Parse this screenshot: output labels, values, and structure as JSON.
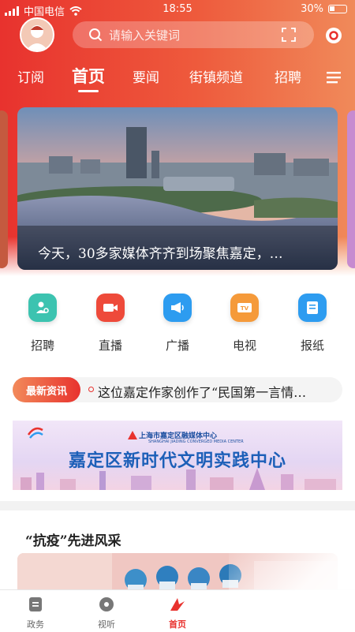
{
  "status_bar": {
    "carrier": "中国电信",
    "time": "18:55",
    "battery": "30%"
  },
  "search": {
    "placeholder": "请输入关键词"
  },
  "nav": {
    "tabs": [
      "订阅",
      "首页",
      "要闻",
      "街镇频道",
      "招聘"
    ],
    "active": "首页"
  },
  "banner": {
    "caption": "今天，30多家媒体齐齐到场聚焦嘉定，…"
  },
  "quick_actions": [
    {
      "label": "招聘",
      "icon": "person-search-icon",
      "color": "#3cc3b0"
    },
    {
      "label": "直播",
      "icon": "video-camera-icon",
      "color": "#ee4a3a"
    },
    {
      "label": "广播",
      "icon": "megaphone-icon",
      "color": "#2d9cf0"
    },
    {
      "label": "电视",
      "icon": "tv-icon",
      "color": "#f59a3a"
    },
    {
      "label": "报纸",
      "icon": "newspaper-icon",
      "color": "#2d9cf0"
    }
  ],
  "news_ticker": {
    "tag": "最新资讯",
    "headline": "这位嘉定作家创作了“民国第一言情…"
  },
  "ad_banner": {
    "org": "上海市嘉定区融媒体中心",
    "org_en": "SHANGHAI JIADING CONVERGED MEDIA CENTER",
    "title": "嘉定区新时代文明实践中心"
  },
  "section": {
    "title": "“抗疫”先进风采"
  },
  "tab_bar": [
    {
      "label": "政务",
      "icon": "document-icon"
    },
    {
      "label": "视听",
      "icon": "disc-icon"
    },
    {
      "label": "首页",
      "icon": "home-logo-icon"
    }
  ],
  "colors": {
    "brand": "#e8322e"
  }
}
